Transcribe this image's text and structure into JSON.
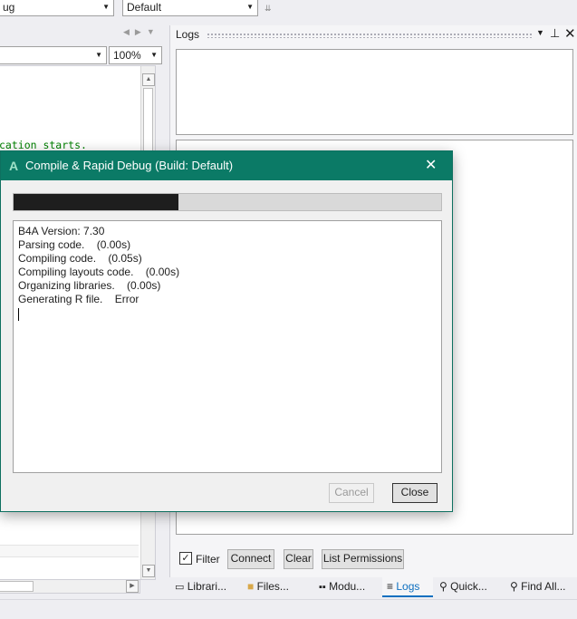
{
  "toolbar": {
    "config_value": "ug",
    "build_value": "Default",
    "overflow_glyph": "⇊"
  },
  "editor": {
    "zoom_value": "100%",
    "code_fragment": "cation starts."
  },
  "logs": {
    "title": "Logs",
    "filter_label": "Filter",
    "filter_checked": true,
    "connect_label": "Connect",
    "clear_label": "Clear",
    "list_permissions_label": "List Permissions"
  },
  "bottom_tabs": [
    {
      "label": "Librari...",
      "icon": "book-icon"
    },
    {
      "label": "Files...",
      "icon": "folder-icon"
    },
    {
      "label": "Modu...",
      "icon": "modules-icon"
    },
    {
      "label": "Logs",
      "icon": "lines-icon",
      "active": true
    },
    {
      "label": "Quick...",
      "icon": "search-icon"
    },
    {
      "label": "Find All...",
      "icon": "find-all-icon"
    }
  ],
  "dialog": {
    "app_glyph": "A",
    "title": "Compile & Rapid Debug (Build: Default)",
    "progress": 0.385,
    "output_lines": [
      "B4A Version: 7.30",
      "Parsing code.    (0.00s)",
      "Compiling code.    (0.05s)",
      "Compiling layouts code.    (0.00s)",
      "Organizing libraries.    (0.00s)",
      "Generating R file.    Error"
    ],
    "cancel_label": "Cancel",
    "close_label": "Close"
  },
  "colors": {
    "dialog_title_bar": "#0b7a66",
    "active_tab": "#0e70c0",
    "code_green": "#008000"
  }
}
